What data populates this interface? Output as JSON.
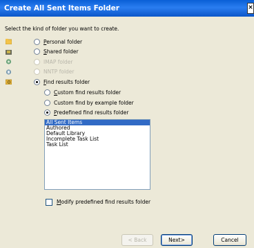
{
  "window": {
    "title": "Create All Sent Items Folder",
    "close_label": "×"
  },
  "instruction": "Select the kind of folder you want to create.",
  "folder_types": [
    {
      "label": "Personal folder",
      "checked": false,
      "enabled": true,
      "icon": "personal-folder-icon"
    },
    {
      "label": "Shared folder",
      "checked": false,
      "enabled": true,
      "icon": "shared-folder-icon"
    },
    {
      "label": "IMAP folder",
      "checked": false,
      "enabled": false,
      "icon": "imap-folder-icon"
    },
    {
      "label": "NNTP folder",
      "checked": false,
      "enabled": false,
      "icon": "nntp-folder-icon"
    },
    {
      "label": "Find results folder",
      "checked": true,
      "enabled": true,
      "icon": "find-results-folder-icon"
    }
  ],
  "find_options": [
    {
      "label": "Custom find results folder",
      "checked": false
    },
    {
      "label": "Custom find by example folder",
      "checked": false
    },
    {
      "label": "Predefined find results folder",
      "checked": true
    }
  ],
  "predefined_list": {
    "items": [
      "All Sent Items",
      "Authored",
      "Default Library",
      "Incomplete Task List",
      "Task List"
    ],
    "selected_index": 0
  },
  "modify_checkbox": {
    "label": "Modify predefined find results folder",
    "checked": false
  },
  "buttons": {
    "back": "< Back",
    "next": "Next>",
    "cancel": "Cancel"
  },
  "colors": {
    "title_bar": "#0a5fd6",
    "selection": "#316ac5",
    "dialog_bg": "#ece9d8"
  }
}
